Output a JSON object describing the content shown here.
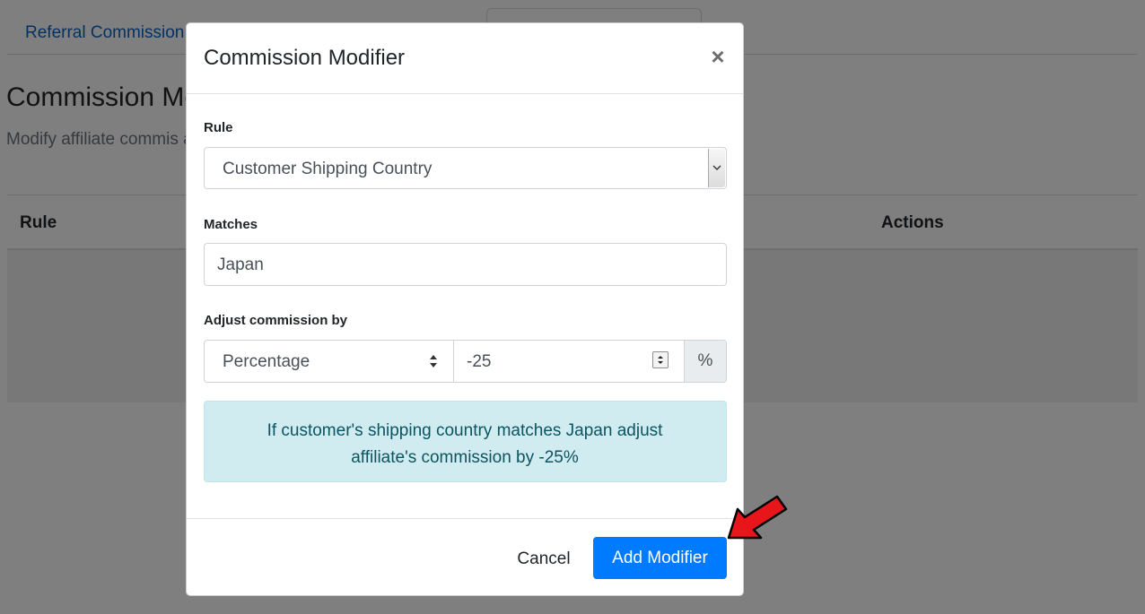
{
  "background": {
    "tab_label": "Referral Commission",
    "heading": "Commission Mo",
    "description": "Modify affiliate commis advanced users only.",
    "table_headers": {
      "rule": "Rule",
      "actions": "Actions"
    }
  },
  "modal": {
    "title": "Commission Modifier",
    "close_symbol": "×",
    "rule": {
      "label": "Rule",
      "selected": "Customer Shipping Country"
    },
    "matches": {
      "label": "Matches",
      "value": "Japan"
    },
    "adjust": {
      "label": "Adjust commission by",
      "type_selected": "Percentage",
      "amount": "-25",
      "unit": "%"
    },
    "summary": "If customer's shipping country matches Japan adjust affiliate's commission by -25%",
    "buttons": {
      "cancel": "Cancel",
      "add": "Add Modifier"
    }
  },
  "colors": {
    "primary": "#007bff",
    "info_bg": "#d1ecf1",
    "info_text": "#0c5460",
    "callout_arrow": "#e8161b"
  },
  "icons": {
    "close": "close-icon",
    "select_arrow": "chevron-down-icon",
    "sort_arrows": "sort-arrows-icon",
    "spinner": "spinner-arrows-icon",
    "callout": "red-arrow-icon"
  }
}
